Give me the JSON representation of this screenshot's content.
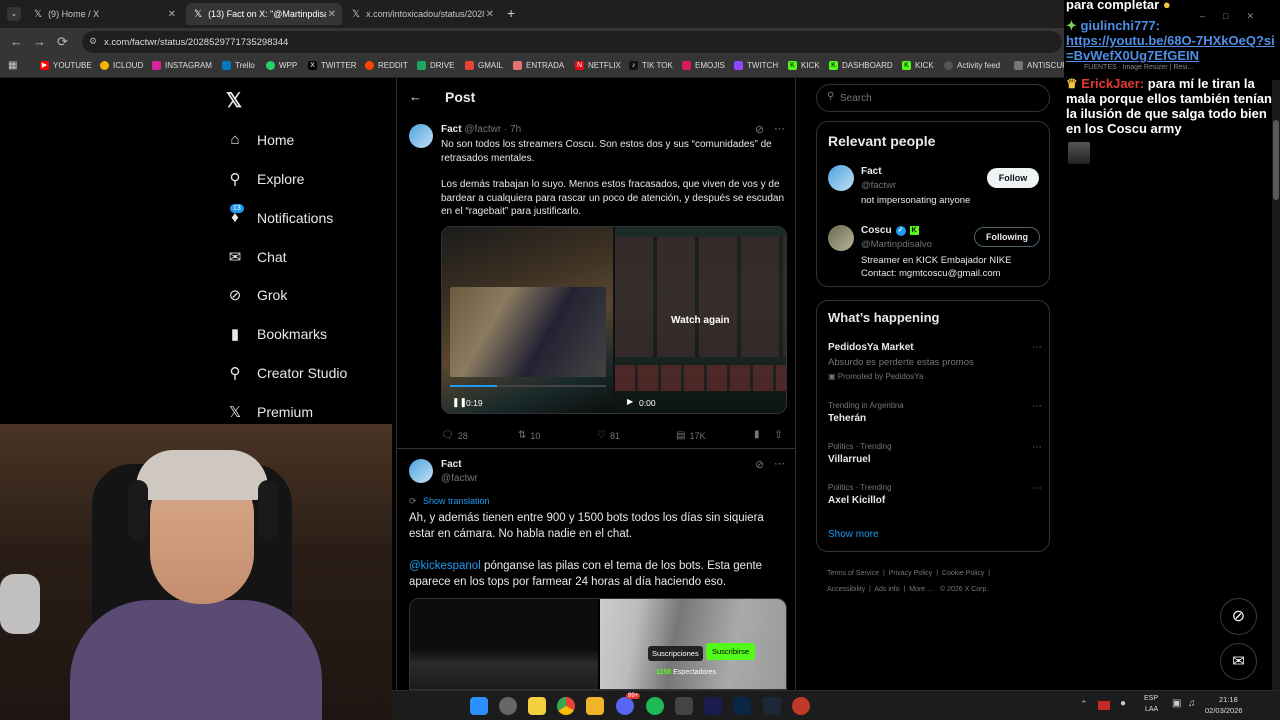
{
  "browser": {
    "tabs": [
      {
        "label": "(9) Home / X",
        "active": false
      },
      {
        "label": "(13) Fact on X: \"@Martinpdisal…",
        "active": true
      },
      {
        "label": "x.com/intoxicadou/status/2028…",
        "active": false
      }
    ],
    "url": "x.com/factwr/status/2028529771735298344",
    "bookmarks": [
      "YOUTUBE",
      "ICLOUD",
      "INSTAGRAM",
      "Trello",
      "WPP",
      "TWITTER",
      "REDDIT",
      "DRIVE",
      "GMAIL",
      "ENTRADA",
      "NETFLIX",
      "TIK TOK",
      "EMOJIS",
      "TWITCH",
      "KICK",
      "DASHBOARD",
      "KICK",
      "Activity feed",
      "ANTISCUFF"
    ]
  },
  "nav": {
    "items": [
      {
        "label": "Home",
        "icon": "home-icon"
      },
      {
        "label": "Explore",
        "icon": "search-icon"
      },
      {
        "label": "Notifications",
        "icon": "bell-icon"
      },
      {
        "label": "Chat",
        "icon": "mail-icon"
      },
      {
        "label": "Grok",
        "icon": "grok-icon"
      },
      {
        "label": "Bookmarks",
        "icon": "bookmark-icon"
      },
      {
        "label": "Creator Studio",
        "icon": "flask-icon"
      },
      {
        "label": "Premium",
        "icon": "x-logo-icon"
      }
    ],
    "notifications_badge": "13"
  },
  "header": {
    "title": "Post"
  },
  "tweet1": {
    "name": "Fact",
    "handle": "@factwr",
    "time": "· 7h",
    "text1": "No son todos los streamers Coscu. Son estos dos y sus “comunidades” de retrasados mentales.",
    "text2": "Los demás trabajan lo suyo. Menos estos fracasados, que viven de vos y de bardear a cualquiera para rascar un poco de atención, y después se escudan en el “ragebait” para justificarlo.",
    "video1_time": "0:19",
    "video2_time": "0:00",
    "watch_again": "Watch again",
    "replies": "28",
    "reposts": "10",
    "likes": "81",
    "views": "17K"
  },
  "tweet2": {
    "name": "Fact",
    "handle": "@factwr",
    "show_translation": "Show translation",
    "text1": "Ah, y además tienen entre 900 y 1500 bots todos los días sin siquiera estar en cámara. No habla nadie en el chat.",
    "mention": "@kickespanol",
    "text2": " pónganse las pilas con el tema de los bots. Esta gente aparece en los tops por farmear 24 horas al día haciendo eso.",
    "img_btn1": "Suscripciones",
    "img_btn2": "Suscribirse",
    "img_viewers": "1158",
    "img_viewers_label": "Espectadores"
  },
  "sidebar": {
    "search_placeholder": "Search",
    "relevant_title": "Relevant people",
    "people": [
      {
        "name": "Fact",
        "handle": "@factwr",
        "bio": "not impersonating anyone",
        "button": "Follow"
      },
      {
        "name": "Coscu",
        "handle": "@Martinpdisalvo",
        "bio": "Streamer en KICK Embajador NIKE Contact: mgmtcoscu@gmail.com",
        "button": "Following"
      }
    ],
    "happening_title": "What’s happening",
    "trends": [
      {
        "meta": "",
        "name": "PedidosYa Market",
        "sub": "Absurdo es perderte estas promos",
        "promo": "Promoted by PedidosYa"
      },
      {
        "meta": "Trending in Argentina",
        "name": "Teherán"
      },
      {
        "meta": "Politics · Trending",
        "name": "Villarruel"
      },
      {
        "meta": "Politics · Trending",
        "name": "Axel Kicillof"
      }
    ],
    "show_more": "Show more",
    "footer": [
      "Terms of Service",
      "Privacy Policy",
      "Cookie Policy",
      "Accessibility",
      "Ads info",
      "More …",
      "© 2026 X Corp."
    ]
  },
  "chat": {
    "line0": "para completar",
    "msg1_user": "giulinchi777:",
    "msg1_link": "https://youtu.be/68O-7HXkOeQ?si=BvWefX0Ug7EfGEIN",
    "msg2_user": "ErickJaer:",
    "msg2_text": " para mí le tiran la mala porque ellos también tenían la ilusión de que salga todo bien en los Coscu army",
    "ghost1": "FUENTES",
    "ghost2": "Image Resizer | Resi..."
  },
  "taskbar": {
    "lang1": "ESP",
    "lang2": "LAA",
    "time": "21:18",
    "date": "02/03/2026",
    "discord_badge": "99+"
  },
  "colors": {
    "accent": "#1d9bf0",
    "kick_green": "#53fc18",
    "chat_blue": "#3b82f6",
    "chat_red": "#e53935"
  }
}
